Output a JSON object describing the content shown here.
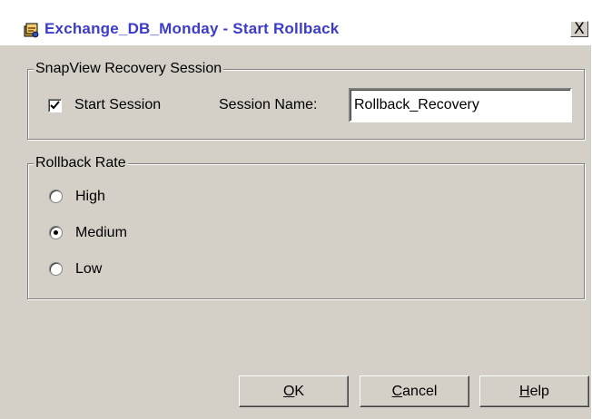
{
  "window": {
    "title": "Exchange_DB_Monday - Start Rollback",
    "close_glyph": "X",
    "icon": "app-icon"
  },
  "recovery_session": {
    "legend": "SnapView Recovery Session",
    "start_session_label": "Start Session",
    "start_session_checked": true,
    "session_name_label": "Session Name:",
    "session_name_value": "Rollback_Recovery"
  },
  "rollback_rate": {
    "legend": "Rollback Rate",
    "options": [
      {
        "label": "High",
        "selected": false
      },
      {
        "label": "Medium",
        "selected": true
      },
      {
        "label": "Low",
        "selected": false
      }
    ]
  },
  "buttons": {
    "ok": {
      "mnemonic": "O",
      "rest": "K"
    },
    "cancel": {
      "mnemonic": "C",
      "rest": "ancel"
    },
    "help": {
      "mnemonic": "H",
      "rest": "elp"
    }
  }
}
